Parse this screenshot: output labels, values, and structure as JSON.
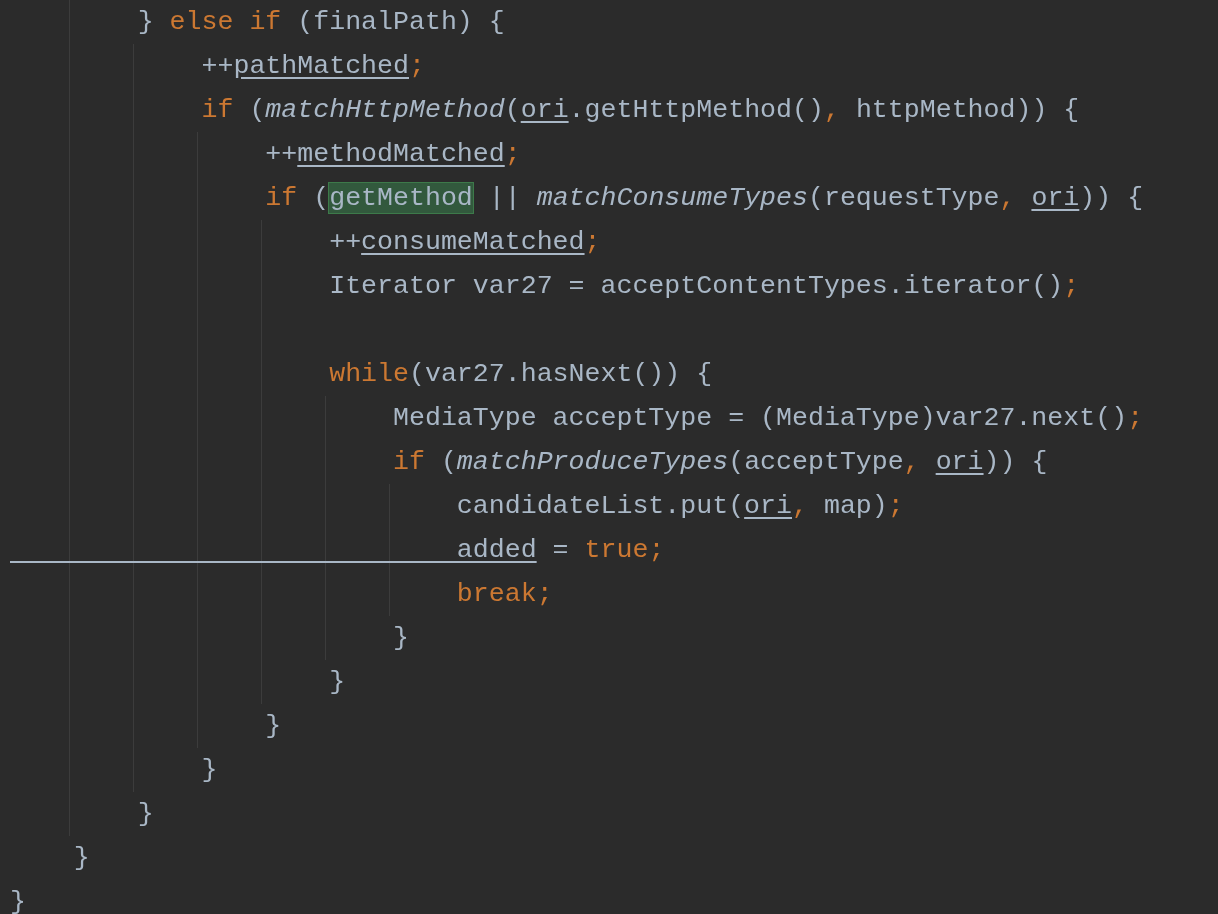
{
  "lines": [
    {
      "kind": "code",
      "tokens": [
        {
          "text": "        } ",
          "kind": "plain"
        },
        {
          "text": "else if",
          "kind": "keyword"
        },
        {
          "text": " (finalPath) {",
          "kind": "plain"
        }
      ]
    },
    {
      "kind": "code",
      "tokens": [
        {
          "text": "            ++",
          "kind": "plain"
        },
        {
          "text": "pathMatched",
          "kind": "reassigned"
        },
        {
          "text": ";",
          "kind": "keyword"
        }
      ]
    },
    {
      "kind": "code",
      "tokens": [
        {
          "text": "            if",
          "kind": "keyword"
        },
        {
          "text": " (",
          "kind": "plain"
        },
        {
          "text": "matchHttpMethod",
          "kind": "static"
        },
        {
          "text": "(",
          "kind": "plain"
        },
        {
          "text": "ori",
          "kind": "reassigned"
        },
        {
          "text": ".getHttpMethod()",
          "kind": "plain"
        },
        {
          "text": ",",
          "kind": "keyword"
        },
        {
          "text": " httpMethod)) {",
          "kind": "plain"
        }
      ]
    },
    {
      "kind": "code",
      "tokens": [
        {
          "text": "                ++",
          "kind": "plain"
        },
        {
          "text": "methodMatched",
          "kind": "reassigned"
        },
        {
          "text": ";",
          "kind": "keyword"
        }
      ]
    },
    {
      "kind": "code",
      "tokens": [
        {
          "text": "                if",
          "kind": "keyword"
        },
        {
          "text": " (",
          "kind": "plain"
        },
        {
          "text": "getMethod",
          "kind": "highlight"
        },
        {
          "text": " || ",
          "kind": "plain"
        },
        {
          "text": "matchConsumeTypes",
          "kind": "static"
        },
        {
          "text": "(requestType",
          "kind": "plain"
        },
        {
          "text": ", ",
          "kind": "keyword"
        },
        {
          "text": "ori",
          "kind": "reassigned"
        },
        {
          "text": ")) {",
          "kind": "plain"
        }
      ]
    },
    {
      "kind": "code",
      "tokens": [
        {
          "text": "                    ++",
          "kind": "plain"
        },
        {
          "text": "consumeMatched",
          "kind": "reassigned"
        },
        {
          "text": ";",
          "kind": "keyword"
        }
      ]
    },
    {
      "kind": "code",
      "tokens": [
        {
          "text": "                    Iterator var27 = acceptContentTypes.iterator()",
          "kind": "plain"
        },
        {
          "text": ";",
          "kind": "keyword"
        }
      ]
    },
    {
      "kind": "blank"
    },
    {
      "kind": "code",
      "tokens": [
        {
          "text": "                    while",
          "kind": "keyword"
        },
        {
          "text": "(var27.hasNext()) {",
          "kind": "plain"
        }
      ]
    },
    {
      "kind": "code",
      "tokens": [
        {
          "text": "                        MediaType acceptType = (MediaType)var27.next()",
          "kind": "plain"
        },
        {
          "text": ";",
          "kind": "keyword"
        }
      ]
    },
    {
      "kind": "code",
      "tokens": [
        {
          "text": "                        if",
          "kind": "keyword"
        },
        {
          "text": " (",
          "kind": "plain"
        },
        {
          "text": "matchProduceTypes",
          "kind": "static"
        },
        {
          "text": "(acceptType",
          "kind": "plain"
        },
        {
          "text": ", ",
          "kind": "keyword"
        },
        {
          "text": "ori",
          "kind": "reassigned"
        },
        {
          "text": ")) {",
          "kind": "plain"
        }
      ]
    },
    {
      "kind": "code",
      "tokens": [
        {
          "text": "                            candidateList.put(",
          "kind": "plain"
        },
        {
          "text": "ori",
          "kind": "reassigned"
        },
        {
          "text": ",",
          "kind": "keyword"
        },
        {
          "text": " map)",
          "kind": "plain"
        },
        {
          "text": ";",
          "kind": "keyword"
        }
      ]
    },
    {
      "kind": "code",
      "tokens": [
        {
          "text": "                            added",
          "kind": "reassigned"
        },
        {
          "text": " = ",
          "kind": "plain"
        },
        {
          "text": "true",
          "kind": "keyword"
        },
        {
          "text": ";",
          "kind": "keyword"
        }
      ]
    },
    {
      "kind": "code",
      "tokens": [
        {
          "text": "                            break",
          "kind": "keyword"
        },
        {
          "text": ";",
          "kind": "keyword"
        }
      ]
    },
    {
      "kind": "code",
      "tokens": [
        {
          "text": "                        }",
          "kind": "plain"
        }
      ]
    },
    {
      "kind": "code",
      "tokens": [
        {
          "text": "                    }",
          "kind": "plain"
        }
      ]
    },
    {
      "kind": "code",
      "tokens": [
        {
          "text": "                }",
          "kind": "plain"
        }
      ]
    },
    {
      "kind": "code",
      "tokens": [
        {
          "text": "            }",
          "kind": "plain"
        }
      ]
    },
    {
      "kind": "code",
      "tokens": [
        {
          "text": "        }",
          "kind": "plain"
        }
      ]
    },
    {
      "kind": "code",
      "tokens": [
        {
          "text": "    }",
          "kind": "plain"
        }
      ]
    },
    {
      "kind": "code",
      "tokens": [
        {
          "text": "}",
          "kind": "plain"
        }
      ]
    }
  ]
}
